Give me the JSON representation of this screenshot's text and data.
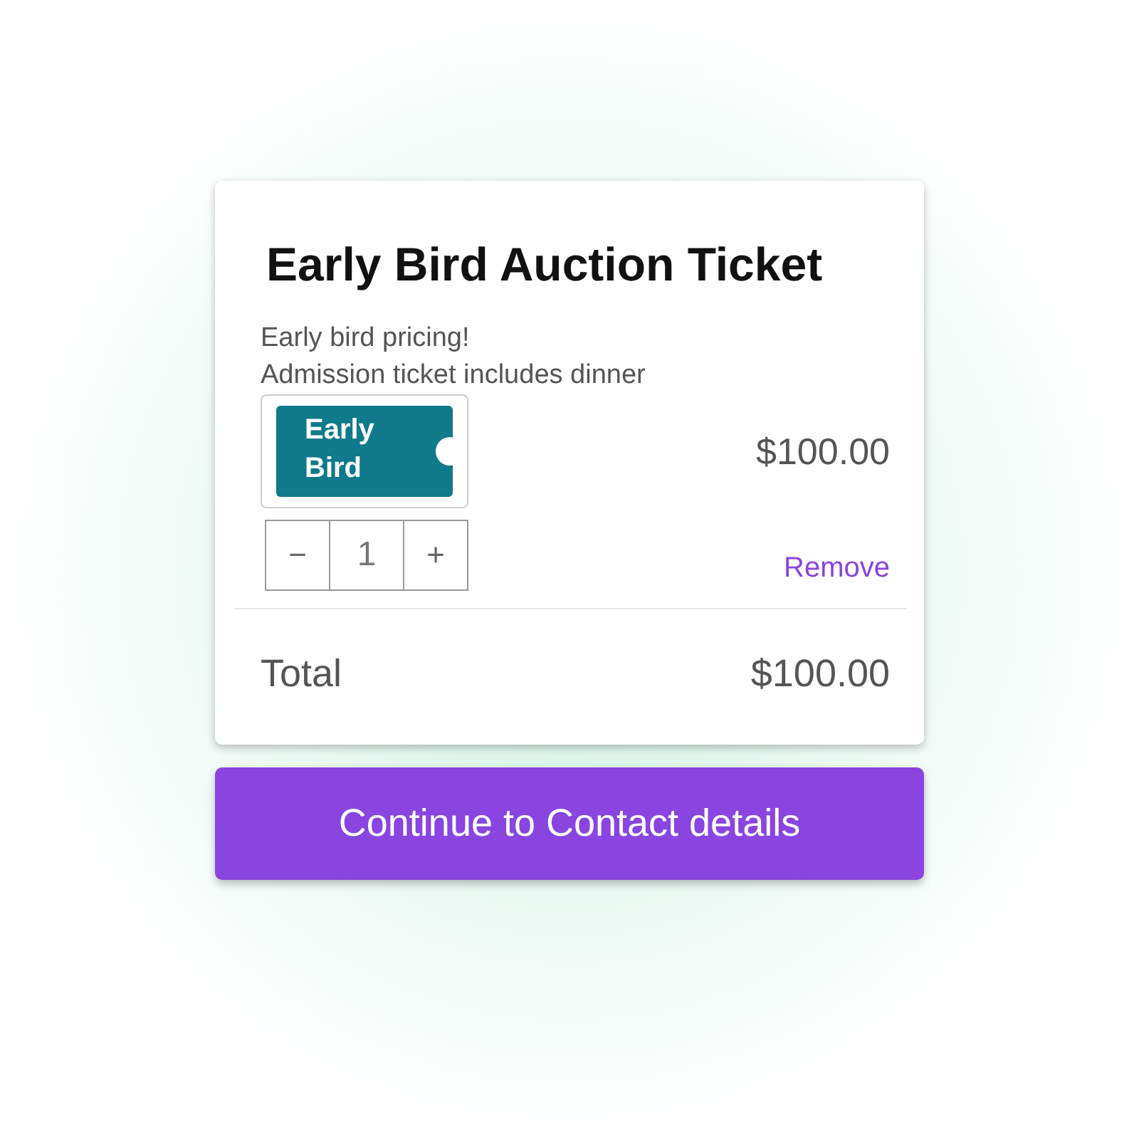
{
  "card": {
    "title": "Early Bird Auction Ticket",
    "description": [
      "Early bird pricing!",
      "Admission ticket includes dinner"
    ],
    "ticket": {
      "image_text": [
        "Early",
        "Bird"
      ],
      "price": "$100.00"
    },
    "quantity": {
      "decrement": "−",
      "value": "1",
      "increment": "+"
    },
    "remove": "Remove",
    "total": {
      "label": "Total",
      "amount": "$100.00"
    }
  },
  "continue_button": "Continue to Contact details"
}
